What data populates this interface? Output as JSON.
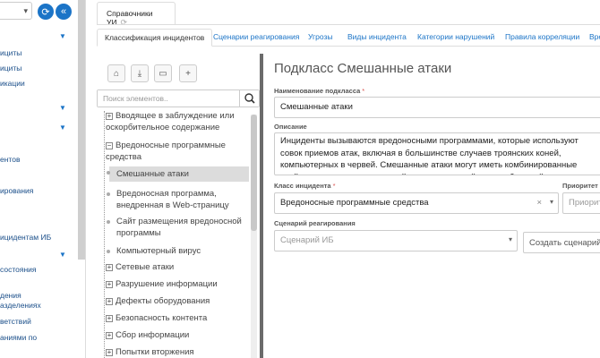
{
  "left_nav": {
    "items": [
      "ициты",
      "ициты",
      "икации",
      "ентов",
      "ирования",
      "ицидентам ИБ",
      "состояния",
      "дения",
      "азделениях",
      "ветствий",
      "аниями по"
    ]
  },
  "window_tab": {
    "label": "Справочники УИ"
  },
  "subtabs": [
    "Классификация инцидентов",
    "Сценарии реагирования",
    "Угрозы",
    "Виды инцидента",
    "Категории нарушений",
    "Правила корреляции",
    "Вре"
  ],
  "tree": {
    "search_placeholder": "Поиск элементов..",
    "items": [
      {
        "label": "Вводящее в заблуждение или оскорбительное содержание",
        "type": "collapsed"
      },
      {
        "label": "Вредоносные программные средства",
        "type": "expanded"
      },
      {
        "label": "Смешанные атаки",
        "type": "leaf",
        "selected": true
      },
      {
        "label": "Вредоносная программа, внедренная в Web-страницу",
        "type": "leaf"
      },
      {
        "label": "Сайт размещения вредоносной программы",
        "type": "leaf"
      },
      {
        "label": "Компьютерный вирус",
        "type": "leaf"
      },
      {
        "label": "Сетевые атаки",
        "type": "collapsed"
      },
      {
        "label": "Разрушение информации",
        "type": "collapsed"
      },
      {
        "label": "Дефекты оборудования",
        "type": "collapsed"
      },
      {
        "label": "Безопасность контента",
        "type": "collapsed"
      },
      {
        "label": "Сбор информации",
        "type": "collapsed"
      },
      {
        "label": "Попытки вторжения",
        "type": "collapsed"
      }
    ]
  },
  "form": {
    "title": "Подкласс Смешанные атаки",
    "name_label": "Наименование подкласса",
    "name_value": "Смешанные атаки",
    "desc_label": "Описание",
    "desc_value": "Инциденты вызываются вредоносными программами, которые используют совок приемов атак, включая в большинстве случаев троянских коней, компьютерных в червей. Смешанные атаки могут иметь комбинированные свойства компьютерных червей, троянских коней или зомби-сетей и т. д. Инциденты смешанных атак также",
    "class_label": "Класс инцидента",
    "class_value": "Вредоносные программные средства",
    "priority_label": "Приоритет",
    "priority_placeholder": "Приорит",
    "scenario_label": "Сценарий реагирования",
    "scenario_placeholder": "Сценарий ИБ",
    "create_button": "Создать сценарий"
  }
}
